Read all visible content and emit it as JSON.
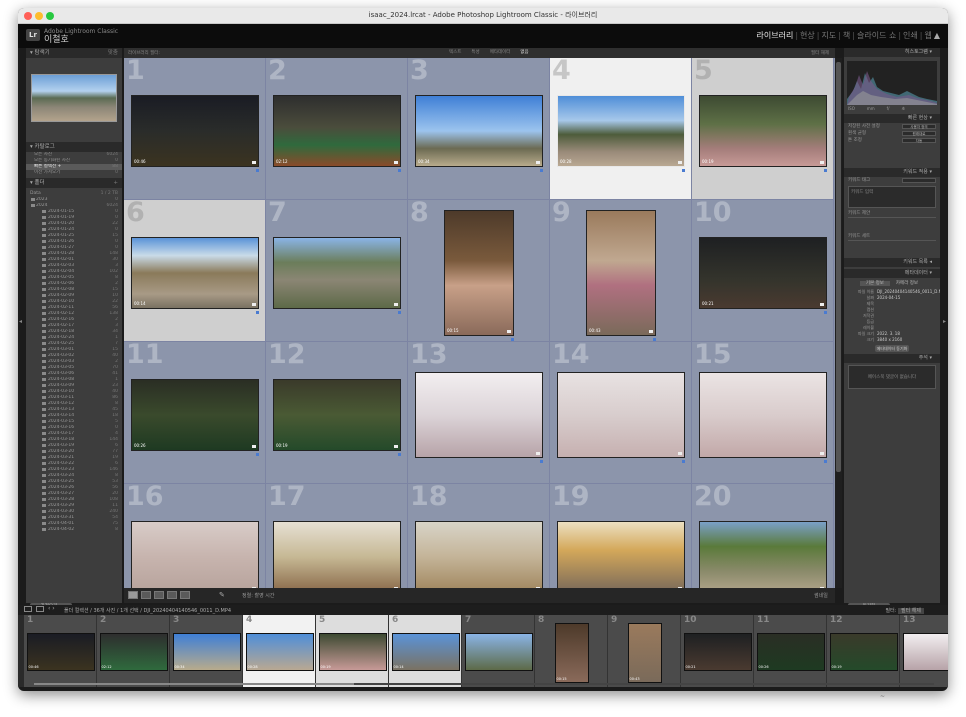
{
  "window": {
    "title": "isaac_2024.lrcat - Adobe Photoshop Lightroom Classic - 라이브러리"
  },
  "identity": {
    "line1": "Adobe Lightroom Classic",
    "line2": "이철호"
  },
  "modules": [
    "라이브러리",
    "현상",
    "지도",
    "책",
    "슬라이드 쇼",
    "인쇄",
    "웹"
  ],
  "active_module": "라이브러리",
  "left_panel": {
    "navigator_header": "탐색기",
    "navigator_zoom": "맞춤",
    "catalog_header": "카탈로그",
    "catalog_items": [
      {
        "label": "모든 사진",
        "count": "6024"
      },
      {
        "label": "모든 동기화된 사진",
        "count": "0"
      },
      {
        "label": "빠른 컬렉션 +",
        "count": "88"
      },
      {
        "label": "이전 가져오기",
        "count": "0"
      }
    ],
    "folders_header": "폴더",
    "drive": "Data",
    "drive_info": "1 / 2 TB",
    "folder_years": [
      {
        "label": "2023",
        "count": "0"
      },
      {
        "label": "2024",
        "count": "6024"
      }
    ],
    "folders": [
      {
        "label": "2024-01-15",
        "count": "0"
      },
      {
        "label": "2024-01-19",
        "count": "0"
      },
      {
        "label": "2024-01-20",
        "count": "22"
      },
      {
        "label": "2024-01-24",
        "count": "0"
      },
      {
        "label": "2024-01-25",
        "count": "15"
      },
      {
        "label": "2024-01-26",
        "count": "0"
      },
      {
        "label": "2024-01-27",
        "count": "0"
      },
      {
        "label": "2024-01-28",
        "count": "148"
      },
      {
        "label": "2024-02-01",
        "count": "30"
      },
      {
        "label": "2024-02-03",
        "count": "3"
      },
      {
        "label": "2024-02-04",
        "count": "102"
      },
      {
        "label": "2024-02-05",
        "count": "8"
      },
      {
        "label": "2024-02-06",
        "count": "2"
      },
      {
        "label": "2024-02-08",
        "count": "15"
      },
      {
        "label": "2024-02-09",
        "count": "10"
      },
      {
        "label": "2024-02-10",
        "count": "22"
      },
      {
        "label": "2024-02-11",
        "count": "56"
      },
      {
        "label": "2024-02-12",
        "count": "138"
      },
      {
        "label": "2024-02-16",
        "count": "2"
      },
      {
        "label": "2024-02-17",
        "count": "3"
      },
      {
        "label": "2024-02-18",
        "count": "34"
      },
      {
        "label": "2024-02-24",
        "count": "1"
      },
      {
        "label": "2024-02-25",
        "count": "7"
      },
      {
        "label": "2024-03-01",
        "count": "15"
      },
      {
        "label": "2024-03-02",
        "count": "40"
      },
      {
        "label": "2024-03-03",
        "count": "2"
      },
      {
        "label": "2024-03-05",
        "count": "70"
      },
      {
        "label": "2024-03-06",
        "count": "41"
      },
      {
        "label": "2024-03-08",
        "count": "1"
      },
      {
        "label": "2024-03-09",
        "count": "23"
      },
      {
        "label": "2024-03-10",
        "count": "40"
      },
      {
        "label": "2024-03-11",
        "count": "86"
      },
      {
        "label": "2024-03-12",
        "count": "8"
      },
      {
        "label": "2024-03-13",
        "count": "45"
      },
      {
        "label": "2024-03-14",
        "count": "18"
      },
      {
        "label": "2024-03-15",
        "count": "5"
      },
      {
        "label": "2024-03-16",
        "count": "0"
      },
      {
        "label": "2024-03-17",
        "count": "4"
      },
      {
        "label": "2024-03-18",
        "count": "144"
      },
      {
        "label": "2024-03-19",
        "count": "6"
      },
      {
        "label": "2024-03-20",
        "count": "77"
      },
      {
        "label": "2024-03-21",
        "count": "19"
      },
      {
        "label": "2024-03-22",
        "count": "6"
      },
      {
        "label": "2024-03-23",
        "count": "146"
      },
      {
        "label": "2024-03-24",
        "count": "8"
      },
      {
        "label": "2024-03-25",
        "count": "53"
      },
      {
        "label": "2024-03-26",
        "count": "56"
      },
      {
        "label": "2024-03-27",
        "count": "20"
      },
      {
        "label": "2024-03-28",
        "count": "108"
      },
      {
        "label": "2024-03-29",
        "count": "11"
      },
      {
        "label": "2024-03-30",
        "count": "240"
      },
      {
        "label": "2024-03-31",
        "count": "54"
      },
      {
        "label": "2024-04-01",
        "count": "75"
      },
      {
        "label": "2024-04-02",
        "count": "8"
      }
    ],
    "import_button": "가져오기...",
    "export_button": "내보내기..."
  },
  "grid_header": {
    "left_text": "라이브러리 필터:",
    "filters": [
      "텍스트",
      "특성",
      "메타데이터",
      "없음"
    ],
    "active_filter": "없음",
    "right_text": "필터 해제"
  },
  "grid": [
    {
      "n": "1",
      "dur": "00:46"
    },
    {
      "n": "2",
      "dur": "02:12"
    },
    {
      "n": "3",
      "dur": "00:34"
    },
    {
      "n": "4",
      "dur": "00:28"
    },
    {
      "n": "5",
      "dur": "00:19"
    },
    {
      "n": "6",
      "dur": "00:14"
    },
    {
      "n": "7",
      "dur": ""
    },
    {
      "n": "8",
      "dur": "00:15"
    },
    {
      "n": "9",
      "dur": "00:43"
    },
    {
      "n": "10",
      "dur": "00:21"
    },
    {
      "n": "11",
      "dur": "00:26"
    },
    {
      "n": "12",
      "dur": "00:19"
    },
    {
      "n": "13",
      "dur": ""
    },
    {
      "n": "14",
      "dur": ""
    },
    {
      "n": "15",
      "dur": ""
    },
    {
      "n": "16",
      "dur": ""
    },
    {
      "n": "17",
      "dur": ""
    },
    {
      "n": "18",
      "dur": ""
    },
    {
      "n": "19",
      "dur": ""
    },
    {
      "n": "20",
      "dur": ""
    }
  ],
  "toolbar": {
    "sort_label": "정렬: 촬영 시간",
    "thumbnails_label": "썸네일"
  },
  "right_panel": {
    "histogram_header": "히스토그램",
    "histogram_readout": [
      "ISO",
      "mm",
      "f/",
      "초"
    ],
    "quick_develop_header": "빠른 현상",
    "quick_develop_rows": [
      {
        "label": "저장된 사전 설정",
        "value": "사용자 정의"
      },
      {
        "label": "흰색 균형",
        "value": "원래대로"
      },
      {
        "label": "톤 조정",
        "value": "자동"
      }
    ],
    "keyword_header": "키워드 적용",
    "keyword_tags_label": "키워드 태그",
    "keyword_placeholder": "키워드 입력",
    "keyword_suggest": "키워드 제안",
    "keyword_set": "키워드 세트",
    "keyword_list_header": "키워드 목록",
    "metadata_header": "메타데이터",
    "metadata_tabs": [
      "기본 정보",
      "카메라 정보"
    ],
    "metadata_rows": [
      {
        "label": "파일 이름",
        "value": "DJI_20240404140546_0011_D.MP4"
      },
      {
        "label": "날짜",
        "value": "2024-04-15"
      },
      {
        "label": "제목",
        "value": ""
      },
      {
        "label": "캡션",
        "value": ""
      },
      {
        "label": "저작권",
        "value": ""
      },
      {
        "label": "등급",
        "value": ""
      },
      {
        "label": "레이블",
        "value": ""
      },
      {
        "label": "파일 크기",
        "value": "2022. 3. 18"
      },
      {
        "label": "크기",
        "value": "3840 x 2160"
      }
    ],
    "metadata_button": "메타데이터 동기화",
    "comments_header": "주석",
    "comments_placeholder": "페이스북 댓글이 없습니다",
    "sync_button": "동기화",
    "sync_settings_button": "설정 동기화"
  },
  "filmstrip": {
    "info": "폴더 컬렉션 / 36개 사진 / 1개 선택 / DJI_20240404140546_0011_D.MP4",
    "filter_label": "필터:",
    "filter_value": "필터 해제",
    "cells": [
      {
        "n": "1",
        "dur": "00:46"
      },
      {
        "n": "2",
        "dur": "02:12"
      },
      {
        "n": "3",
        "dur": "00:34"
      },
      {
        "n": "4",
        "dur": "00:28"
      },
      {
        "n": "5",
        "dur": "00:19"
      },
      {
        "n": "6",
        "dur": "00:14"
      },
      {
        "n": "7",
        "dur": ""
      },
      {
        "n": "8",
        "dur": "00:15"
      },
      {
        "n": "9",
        "dur": "00:43"
      },
      {
        "n": "10",
        "dur": "00:21"
      },
      {
        "n": "11",
        "dur": "00:26"
      },
      {
        "n": "12",
        "dur": "00:19"
      },
      {
        "n": "13",
        "dur": ""
      }
    ]
  },
  "colors": {
    "grid_bg": "#8a93a9",
    "panel_bg": "#3d3d3d",
    "selected_cell": "#f0f0f0"
  }
}
